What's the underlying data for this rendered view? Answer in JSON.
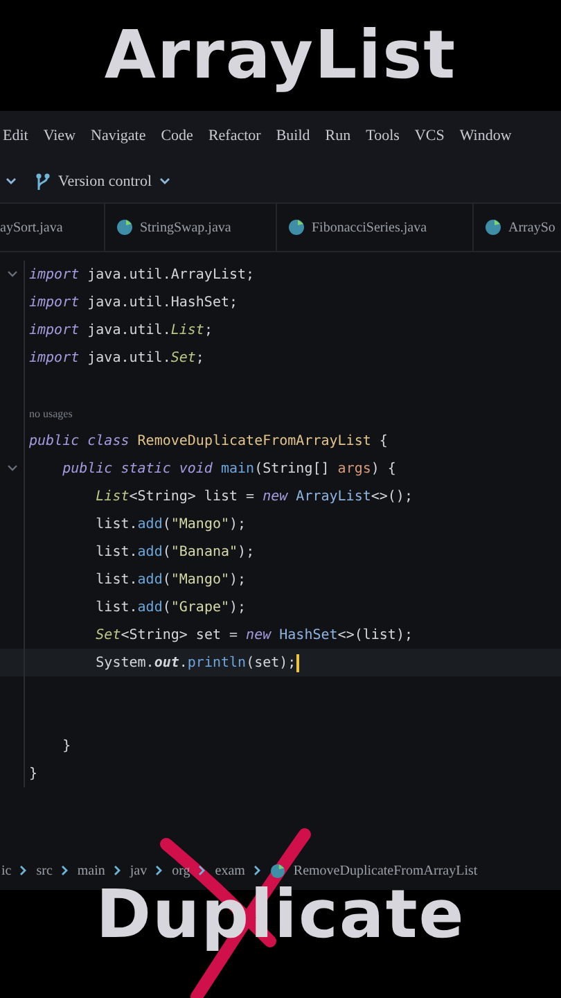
{
  "top_title": "ArrayList",
  "menu": [
    "Edit",
    "View",
    "Navigate",
    "Code",
    "Refactor",
    "Build",
    "Run",
    "Tools",
    "VCS",
    "Window"
  ],
  "toolbar": {
    "vcs_label": "Version control"
  },
  "tabs": [
    {
      "label": "aySort.java",
      "icon": false
    },
    {
      "label": "StringSwap.java",
      "icon": true
    },
    {
      "label": "FibonacciSeries.java",
      "icon": true
    },
    {
      "label": "ArraySo",
      "icon": true
    }
  ],
  "code": [
    {
      "fold": true,
      "current": false,
      "tokens": [
        {
          "kind": "keyword",
          "text": "import"
        },
        {
          "kind": "plain",
          "text": " java.util.ArrayList;"
        }
      ]
    },
    {
      "fold": false,
      "current": false,
      "tokens": [
        {
          "kind": "keyword",
          "text": "import"
        },
        {
          "kind": "plain",
          "text": " java.util.HashSet;"
        }
      ]
    },
    {
      "fold": false,
      "current": false,
      "tokens": [
        {
          "kind": "keyword",
          "text": "import"
        },
        {
          "kind": "plain",
          "text": " java.util."
        },
        {
          "kind": "iface",
          "text": "List"
        },
        {
          "kind": "plain",
          "text": ";"
        }
      ]
    },
    {
      "fold": false,
      "current": false,
      "tokens": [
        {
          "kind": "keyword",
          "text": "import"
        },
        {
          "kind": "plain",
          "text": " java.util."
        },
        {
          "kind": "iface",
          "text": "Set"
        },
        {
          "kind": "plain",
          "text": ";"
        }
      ]
    },
    {
      "fold": false,
      "current": false
    },
    {
      "fold": false,
      "current": false,
      "hint": "no usages"
    },
    {
      "fold": false,
      "current": false,
      "tokens": [
        {
          "kind": "keyword",
          "text": "public class "
        },
        {
          "kind": "classname",
          "text": "RemoveDuplicateFromArrayList"
        },
        {
          "kind": "plain",
          "text": " {"
        }
      ]
    },
    {
      "fold": true,
      "current": false,
      "tokens": [
        {
          "kind": "keyword",
          "text": "    public static void "
        },
        {
          "kind": "method",
          "text": "main"
        },
        {
          "kind": "plain",
          "text": "(String[] "
        },
        {
          "kind": "param",
          "text": "args"
        },
        {
          "kind": "plain",
          "text": ") {"
        }
      ]
    },
    {
      "fold": false,
      "current": false,
      "tokens": [
        {
          "kind": "iface",
          "text": "        List"
        },
        {
          "kind": "plain",
          "text": "<String> list = "
        },
        {
          "kind": "keyword",
          "text": "new "
        },
        {
          "kind": "type",
          "text": "ArrayList"
        },
        {
          "kind": "plain",
          "text": "<>();"
        }
      ]
    },
    {
      "fold": false,
      "current": false,
      "tokens": [
        {
          "kind": "plain",
          "text": "        list."
        },
        {
          "kind": "method",
          "text": "add"
        },
        {
          "kind": "plain",
          "text": "("
        },
        {
          "kind": "string",
          "text": "\"Mango\""
        },
        {
          "kind": "plain",
          "text": ");"
        }
      ]
    },
    {
      "fold": false,
      "current": false,
      "tokens": [
        {
          "kind": "plain",
          "text": "        list."
        },
        {
          "kind": "method",
          "text": "add"
        },
        {
          "kind": "plain",
          "text": "("
        },
        {
          "kind": "string",
          "text": "\"Banana\""
        },
        {
          "kind": "plain",
          "text": ");"
        }
      ]
    },
    {
      "fold": false,
      "current": false,
      "tokens": [
        {
          "kind": "plain",
          "text": "        list."
        },
        {
          "kind": "method",
          "text": "add"
        },
        {
          "kind": "plain",
          "text": "("
        },
        {
          "kind": "string",
          "text": "\"Mango\""
        },
        {
          "kind": "plain",
          "text": ");"
        }
      ]
    },
    {
      "fold": false,
      "current": false,
      "tokens": [
        {
          "kind": "plain",
          "text": "        list."
        },
        {
          "kind": "method",
          "text": "add"
        },
        {
          "kind": "plain",
          "text": "("
        },
        {
          "kind": "string",
          "text": "\"Grape\""
        },
        {
          "kind": "plain",
          "text": ");"
        }
      ]
    },
    {
      "fold": false,
      "current": false,
      "tokens": [
        {
          "kind": "iface",
          "text": "        Set"
        },
        {
          "kind": "plain",
          "text": "<String> set = "
        },
        {
          "kind": "keyword",
          "text": "new "
        },
        {
          "kind": "type",
          "text": "HashSet"
        },
        {
          "kind": "plain",
          "text": "<>(list);"
        }
      ]
    },
    {
      "fold": false,
      "current": true,
      "tokens": [
        {
          "kind": "plain",
          "text": "        System."
        },
        {
          "kind": "field",
          "text": "out"
        },
        {
          "kind": "plain",
          "text": "."
        },
        {
          "kind": "method",
          "text": "println"
        },
        {
          "kind": "plain",
          "text": "(set);"
        }
      ]
    },
    {
      "fold": false,
      "current": false
    },
    {
      "fold": false,
      "current": false
    },
    {
      "fold": false,
      "current": false,
      "tokens": [
        {
          "kind": "plain",
          "text": "    }"
        }
      ]
    },
    {
      "fold": false,
      "current": false,
      "tokens": [
        {
          "kind": "plain",
          "text": "}"
        }
      ]
    }
  ],
  "breadcrumbs": [
    {
      "kind": "folder",
      "text": "ic"
    },
    {
      "kind": "folder",
      "text": "src"
    },
    {
      "kind": "folder",
      "text": "main"
    },
    {
      "kind": "folder",
      "text": "jav"
    },
    {
      "kind": "folder",
      "text": "org"
    },
    {
      "kind": "folder",
      "text": "exam"
    },
    {
      "kind": "class",
      "text": "RemoveDuplicateFromArrayList"
    }
  ],
  "bottom_title": "Duplicate"
}
